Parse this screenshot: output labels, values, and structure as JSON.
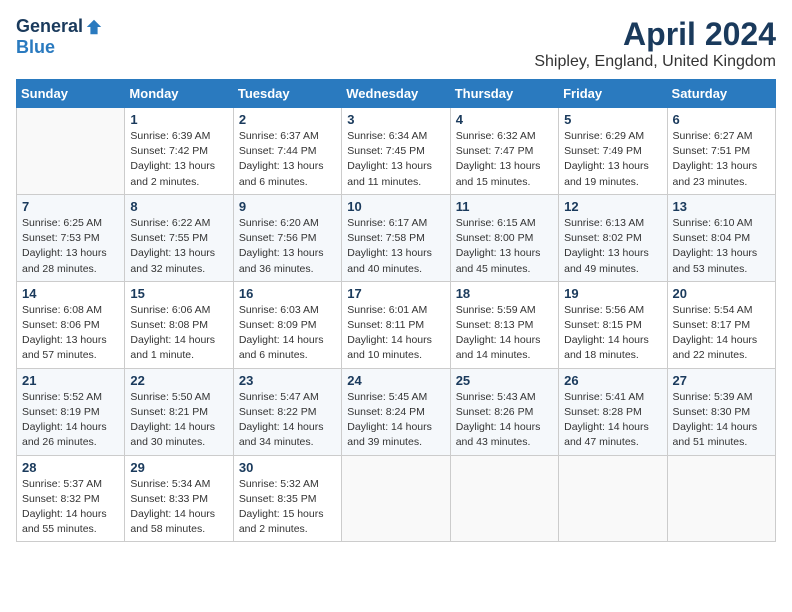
{
  "logo": {
    "general": "General",
    "blue": "Blue"
  },
  "title": "April 2024",
  "subtitle": "Shipley, England, United Kingdom",
  "days_of_week": [
    "Sunday",
    "Monday",
    "Tuesday",
    "Wednesday",
    "Thursday",
    "Friday",
    "Saturday"
  ],
  "weeks": [
    [
      {
        "day": "",
        "detail": ""
      },
      {
        "day": "1",
        "detail": "Sunrise: 6:39 AM\nSunset: 7:42 PM\nDaylight: 13 hours\nand 2 minutes."
      },
      {
        "day": "2",
        "detail": "Sunrise: 6:37 AM\nSunset: 7:44 PM\nDaylight: 13 hours\nand 6 minutes."
      },
      {
        "day": "3",
        "detail": "Sunrise: 6:34 AM\nSunset: 7:45 PM\nDaylight: 13 hours\nand 11 minutes."
      },
      {
        "day": "4",
        "detail": "Sunrise: 6:32 AM\nSunset: 7:47 PM\nDaylight: 13 hours\nand 15 minutes."
      },
      {
        "day": "5",
        "detail": "Sunrise: 6:29 AM\nSunset: 7:49 PM\nDaylight: 13 hours\nand 19 minutes."
      },
      {
        "day": "6",
        "detail": "Sunrise: 6:27 AM\nSunset: 7:51 PM\nDaylight: 13 hours\nand 23 minutes."
      }
    ],
    [
      {
        "day": "7",
        "detail": "Sunrise: 6:25 AM\nSunset: 7:53 PM\nDaylight: 13 hours\nand 28 minutes."
      },
      {
        "day": "8",
        "detail": "Sunrise: 6:22 AM\nSunset: 7:55 PM\nDaylight: 13 hours\nand 32 minutes."
      },
      {
        "day": "9",
        "detail": "Sunrise: 6:20 AM\nSunset: 7:56 PM\nDaylight: 13 hours\nand 36 minutes."
      },
      {
        "day": "10",
        "detail": "Sunrise: 6:17 AM\nSunset: 7:58 PM\nDaylight: 13 hours\nand 40 minutes."
      },
      {
        "day": "11",
        "detail": "Sunrise: 6:15 AM\nSunset: 8:00 PM\nDaylight: 13 hours\nand 45 minutes."
      },
      {
        "day": "12",
        "detail": "Sunrise: 6:13 AM\nSunset: 8:02 PM\nDaylight: 13 hours\nand 49 minutes."
      },
      {
        "day": "13",
        "detail": "Sunrise: 6:10 AM\nSunset: 8:04 PM\nDaylight: 13 hours\nand 53 minutes."
      }
    ],
    [
      {
        "day": "14",
        "detail": "Sunrise: 6:08 AM\nSunset: 8:06 PM\nDaylight: 13 hours\nand 57 minutes."
      },
      {
        "day": "15",
        "detail": "Sunrise: 6:06 AM\nSunset: 8:08 PM\nDaylight: 14 hours\nand 1 minute."
      },
      {
        "day": "16",
        "detail": "Sunrise: 6:03 AM\nSunset: 8:09 PM\nDaylight: 14 hours\nand 6 minutes."
      },
      {
        "day": "17",
        "detail": "Sunrise: 6:01 AM\nSunset: 8:11 PM\nDaylight: 14 hours\nand 10 minutes."
      },
      {
        "day": "18",
        "detail": "Sunrise: 5:59 AM\nSunset: 8:13 PM\nDaylight: 14 hours\nand 14 minutes."
      },
      {
        "day": "19",
        "detail": "Sunrise: 5:56 AM\nSunset: 8:15 PM\nDaylight: 14 hours\nand 18 minutes."
      },
      {
        "day": "20",
        "detail": "Sunrise: 5:54 AM\nSunset: 8:17 PM\nDaylight: 14 hours\nand 22 minutes."
      }
    ],
    [
      {
        "day": "21",
        "detail": "Sunrise: 5:52 AM\nSunset: 8:19 PM\nDaylight: 14 hours\nand 26 minutes."
      },
      {
        "day": "22",
        "detail": "Sunrise: 5:50 AM\nSunset: 8:21 PM\nDaylight: 14 hours\nand 30 minutes."
      },
      {
        "day": "23",
        "detail": "Sunrise: 5:47 AM\nSunset: 8:22 PM\nDaylight: 14 hours\nand 34 minutes."
      },
      {
        "day": "24",
        "detail": "Sunrise: 5:45 AM\nSunset: 8:24 PM\nDaylight: 14 hours\nand 39 minutes."
      },
      {
        "day": "25",
        "detail": "Sunrise: 5:43 AM\nSunset: 8:26 PM\nDaylight: 14 hours\nand 43 minutes."
      },
      {
        "day": "26",
        "detail": "Sunrise: 5:41 AM\nSunset: 8:28 PM\nDaylight: 14 hours\nand 47 minutes."
      },
      {
        "day": "27",
        "detail": "Sunrise: 5:39 AM\nSunset: 8:30 PM\nDaylight: 14 hours\nand 51 minutes."
      }
    ],
    [
      {
        "day": "28",
        "detail": "Sunrise: 5:37 AM\nSunset: 8:32 PM\nDaylight: 14 hours\nand 55 minutes."
      },
      {
        "day": "29",
        "detail": "Sunrise: 5:34 AM\nSunset: 8:33 PM\nDaylight: 14 hours\nand 58 minutes."
      },
      {
        "day": "30",
        "detail": "Sunrise: 5:32 AM\nSunset: 8:35 PM\nDaylight: 15 hours\nand 2 minutes."
      },
      {
        "day": "",
        "detail": ""
      },
      {
        "day": "",
        "detail": ""
      },
      {
        "day": "",
        "detail": ""
      },
      {
        "day": "",
        "detail": ""
      }
    ]
  ]
}
